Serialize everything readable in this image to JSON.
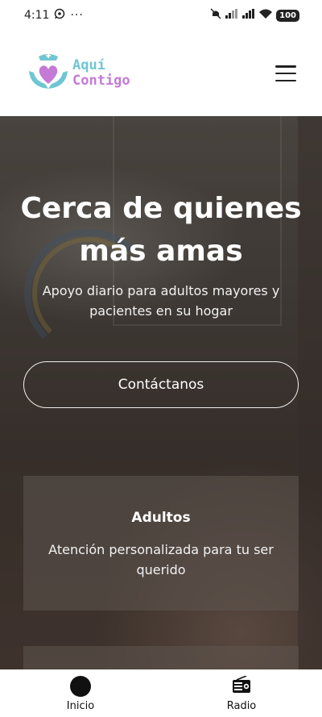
{
  "status": {
    "time": "4:11",
    "battery": "100"
  },
  "brand": {
    "line1": "Aquí",
    "line2": "Contigo",
    "colors": {
      "teal": "#6fc6d2",
      "purple": "#c57ad6"
    }
  },
  "hero": {
    "title_line1": "Cerca de quienes",
    "title_line2": "más amas",
    "subtitle": "Apoyo diario para adultos mayores y pacientes en su hogar",
    "cta_label": "Contáctanos"
  },
  "cards": [
    {
      "title": "Adultos",
      "description": "Atención personalizada para tu ser querido"
    }
  ],
  "bottom_nav": {
    "items": [
      {
        "label": "Inicio",
        "icon": "circle-icon"
      },
      {
        "label": "Radio",
        "icon": "radio-icon"
      }
    ]
  }
}
